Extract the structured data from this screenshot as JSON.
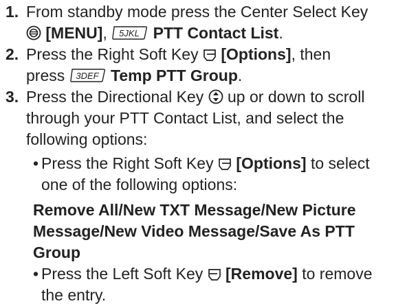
{
  "step1": {
    "num": "1.",
    "text_a": "From standby mode press the Center Select Key",
    "menu": "[MENU]",
    "sep": ",",
    "key_label": "5JKL",
    "contact_list": "PTT Contact List",
    "end": "."
  },
  "step2": {
    "num": "2.",
    "text_a": "Press the Right Soft Key",
    "options": "[Options]",
    "text_b": ", then",
    "text_c": "press",
    "key_label": "3DEF",
    "temp_group": "Temp PTT Group",
    "end": "."
  },
  "step3": {
    "num": "3.",
    "text_a": "Press the Directional Key",
    "text_b": "up or down to scroll",
    "line2": "through your PTT Contact List, and select the",
    "line3": "following options:"
  },
  "bullet1": {
    "mark": "•",
    "text_a": "Press the Right Soft Key",
    "options": "[Options]",
    "text_b": "to select",
    "line2": "one of the following options:"
  },
  "option_list": {
    "line1": "Remove All/New TXT Message/New Picture",
    "line2": "Message/New Video Message/Save As PTT",
    "line3": "Group"
  },
  "bullet2": {
    "mark": "•",
    "text_a": "Press the Left Soft Key",
    "remove": "[Remove]",
    "text_b": "to remove",
    "line2": "the entry."
  }
}
